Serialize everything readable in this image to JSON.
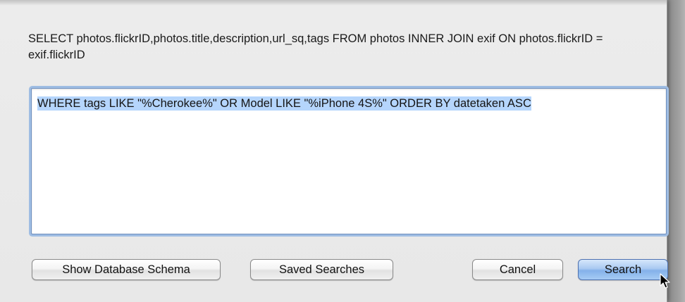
{
  "dialog": {
    "query_prefix": "SELECT photos.flickrID,photos.title,description,url_sq,tags FROM photos INNER JOIN exif ON photos.flickrID = exif.flickrID",
    "where_clause": "WHERE tags LIKE \"%Cherokee%\" OR Model LIKE \"%iPhone 4S%\" ORDER BY datetaken ASC"
  },
  "buttons": {
    "show_schema": "Show Database Schema",
    "saved_searches": "Saved Searches",
    "cancel": "Cancel",
    "search": "Search"
  },
  "colors": {
    "sheet_background": "#ececec",
    "focus_ring": "#9fbde3",
    "text_selection": "#b5d5fc",
    "default_button": "#84b1ea"
  },
  "icons": {
    "cursor": "arrow-pointer-icon"
  }
}
